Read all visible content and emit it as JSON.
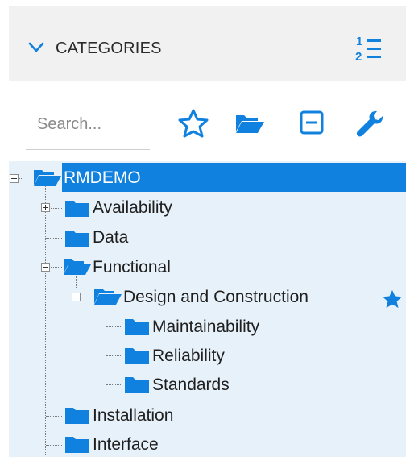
{
  "header": {
    "title": "CATEGORIES",
    "collapse_icon": "chevron-down-icon",
    "sort_icon": "numbered-list-icon"
  },
  "search": {
    "placeholder": "Search..."
  },
  "toolbar": {
    "icons": [
      "star-outline-icon",
      "folder-open-icon",
      "collapse-square-icon",
      "wrench-icon"
    ]
  },
  "colors": {
    "accent": "#1081de",
    "folder": "#1081de",
    "tree_bg": "#e7f1f9",
    "header_bg": "#f1f1f1"
  },
  "tree": {
    "root": {
      "label": "RMDEMO",
      "expanded": true,
      "selected": true
    },
    "items": [
      {
        "label": "Availability",
        "level": 1,
        "expander": "plus"
      },
      {
        "label": "Data",
        "level": 1,
        "expander": "none"
      },
      {
        "label": "Functional",
        "level": 1,
        "expander": "minus"
      },
      {
        "label": "Design and Construction",
        "level": 2,
        "expander": "minus",
        "favorite": true
      },
      {
        "label": "Maintainability",
        "level": 3,
        "expander": "none"
      },
      {
        "label": "Reliability",
        "level": 3,
        "expander": "none"
      },
      {
        "label": "Standards",
        "level": 3,
        "expander": "none"
      },
      {
        "label": "Installation",
        "level": 1,
        "expander": "none"
      },
      {
        "label": "Interface",
        "level": 1,
        "expander": "none"
      }
    ]
  }
}
